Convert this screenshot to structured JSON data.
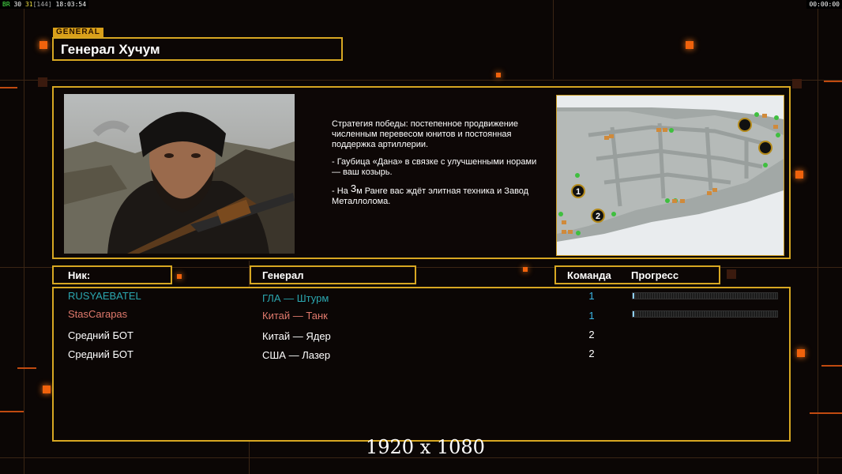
{
  "hud": {
    "left_prefix": "BR",
    "left_fps": "30",
    "left_num": "31",
    "left_bracket": "[144]",
    "left_clock": "18:03:54",
    "right_timer": "00:00:00"
  },
  "general_tab_label": "GENERAL",
  "title": "Генерал Хучум",
  "description": {
    "para1": "Стратегия победы: постепенное продвижение численным перевесом юнитов и постоянная поддержка артиллерии.",
    "para2": "- Гаубица «Дана» в связке с улучшенными норами — ваш козырь.",
    "para3_prefix": "- На ",
    "para3_num": "3",
    "para3_suffix": "м Ранге вас ждёт элитная техника и Завод Металлолома."
  },
  "minimap": {
    "start_labels": [
      "1",
      "2"
    ]
  },
  "headers": {
    "nick": "Ник:",
    "general": "Генерал",
    "team": "Команда",
    "progress": "Прогресс"
  },
  "players": [
    {
      "nick": "RUSYAEBATEL",
      "general": "ГЛА — Штурм",
      "team": "1",
      "color": "#2ba7b0",
      "progress": 0.01
    },
    {
      "nick": "StasCarapas",
      "general": "Китай — Танк",
      "team": "1",
      "color": "#e0796c",
      "progress": 0.01
    },
    {
      "nick": "Средний БОТ",
      "general": "Китай — Ядер",
      "team": "2",
      "color": "#ffffff"
    },
    {
      "nick": "Средний БОТ",
      "general": "США — Лазер",
      "team": "2",
      "color": "#ffffff"
    }
  ],
  "resolution_label": "1920 x 1080",
  "colors": {
    "accent_gold": "#d7a722",
    "accent_orange": "#f0620c"
  }
}
